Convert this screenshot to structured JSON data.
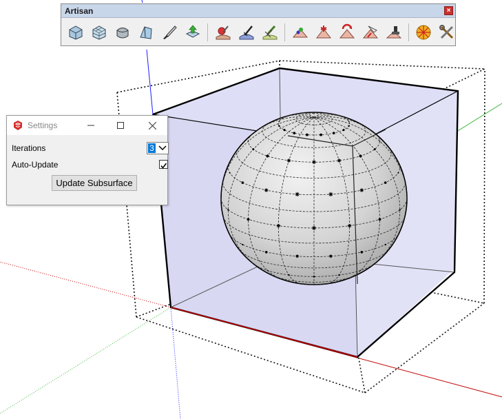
{
  "toolbar": {
    "title": "Artisan",
    "close_glyph": "×",
    "icons": [
      "subdivide-smooth-icon",
      "subdivide-icon",
      "smooth-icon",
      "crease-tool-icon",
      "knife-tool-icon",
      "extrude-icon",
      "sculpt-tool-icon",
      "pinch-brush-icon",
      "smooth-brush-icon",
      "flatten-brush-icon",
      "inflate-brush-icon",
      "pull-brush-icon",
      "paint-select-icon",
      "stamp-tool-icon",
      "organizer-icon",
      "settings-tools-icon"
    ]
  },
  "settings_dialog": {
    "title": "Settings",
    "iterations_label": "Iterations",
    "iterations_value": "3",
    "auto_update_label": "Auto-Update",
    "auto_update_checked": true,
    "update_button": "Update Subsurface"
  },
  "colors": {
    "axis_red": "#c00000",
    "axis_green": "#3cb83c",
    "axis_blue": "#1a1aff",
    "cube_face": "#dcdcf6",
    "toolbar_title_bg": "#c8d6ea"
  }
}
